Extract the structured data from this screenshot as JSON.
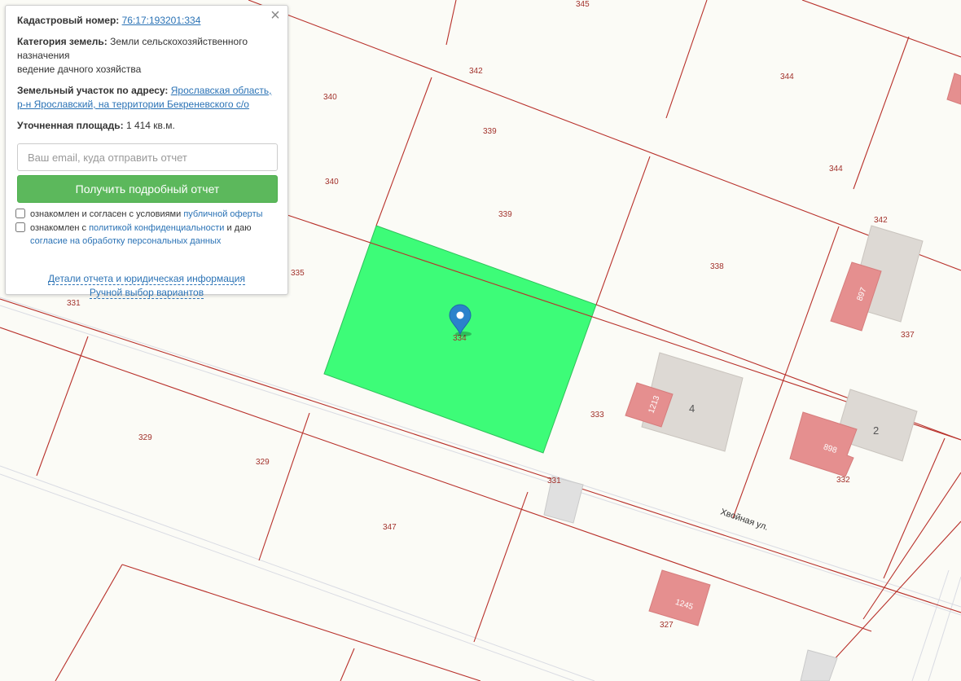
{
  "info_panel": {
    "close_symbol": "×",
    "cadastral_label": "Кадастровый номер:",
    "cadastral_number": "76:17:193201:334",
    "category_label": "Категория земель:",
    "category_value_line1": "Земли сельскохозяйственного",
    "category_value_line2": "назначения",
    "category_value_line3": "ведение дачного хозяйства",
    "address_label": "Земельный участок по адресу:",
    "address_line1": "Ярославская область,",
    "address_line2": "р-н Ярославский, на территории Бекреневского с/о",
    "area_label": "Уточненная площадь:",
    "area_value": "1 414 кв.м.",
    "email_placeholder": "Ваш email, куда отправить отчет",
    "email_value": "",
    "report_button": "Получить подробный отчет",
    "consent1_text": "ознакомлен и согласен с условиями",
    "consent1_link": "публичной оферты",
    "consent2_text": "ознакомлен с",
    "consent2_link": "политикой конфиденциальности",
    "consent2_text2": "и даю",
    "consent2_link2": "согласие на обработку персональных данных",
    "details_link": "Детали отчета и юридическая информация",
    "manual_link": "Ручной выбор вариантов"
  },
  "map": {
    "selected_plot_color": "#3dfc78",
    "boundary_color": "#b8302a",
    "building_color": "#e58f8f",
    "plot_labels": {
      "p345": "345",
      "p344a": "344",
      "p344b": "344",
      "p342a": "342",
      "p342b": "342",
      "p340a": "340",
      "p340b": "340",
      "p339a": "339",
      "p339b": "339",
      "p338": "338",
      "p335": "335",
      "p331a": "331",
      "p331b": "331",
      "p334": "334",
      "p333": "333",
      "p337": "337",
      "p332": "332",
      "p329a": "329",
      "p329b": "329",
      "p347": "347",
      "p327": "327"
    },
    "building_labels": {
      "b897": "897",
      "b1213": "1213",
      "b898": "898",
      "b1245": "1245"
    },
    "house_numbers": {
      "h4": "4",
      "h2": "2"
    },
    "street_name": "Хвойная ул.",
    "marker_icon": "map-pin-icon"
  }
}
